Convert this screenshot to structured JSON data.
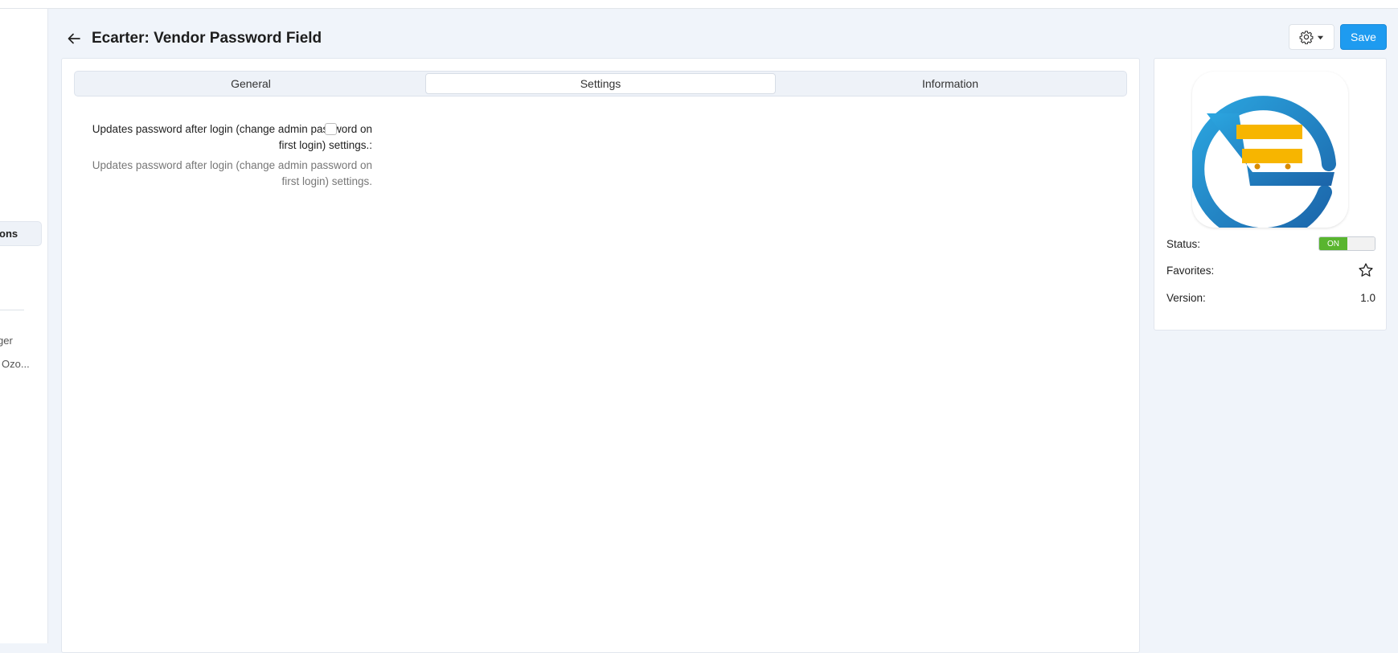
{
  "page": {
    "title": "Ecarter: Vendor Password Field"
  },
  "toolbar": {
    "save_label": "Save"
  },
  "sidebar": {
    "items": [
      {
        "label": "ons",
        "active": true
      },
      {
        "label": "ger"
      },
      {
        "label": "Ozo..."
      }
    ]
  },
  "tabs": [
    {
      "label": "General"
    },
    {
      "label": "Settings",
      "active": true
    },
    {
      "label": "Information"
    }
  ],
  "settings": {
    "password_update": {
      "label": "Updates password after login (change admin password on first login) settings.:",
      "help": "Updates password after login (change admin password on first login) settings.",
      "checked": false
    }
  },
  "info": {
    "status_label": "Status:",
    "status_value": "ON",
    "favorites_label": "Favorites:",
    "version_label": "Version:",
    "version_value": "1.0"
  },
  "icons": {
    "back": "arrow-left-icon",
    "gear": "gear-icon",
    "caret": "caret-down-icon",
    "star": "star-icon"
  },
  "colors": {
    "accent": "#1e9bf0",
    "status_on": "#59b52f",
    "logo_blue": "#1f7fc0",
    "logo_yellow": "#f7b500"
  }
}
